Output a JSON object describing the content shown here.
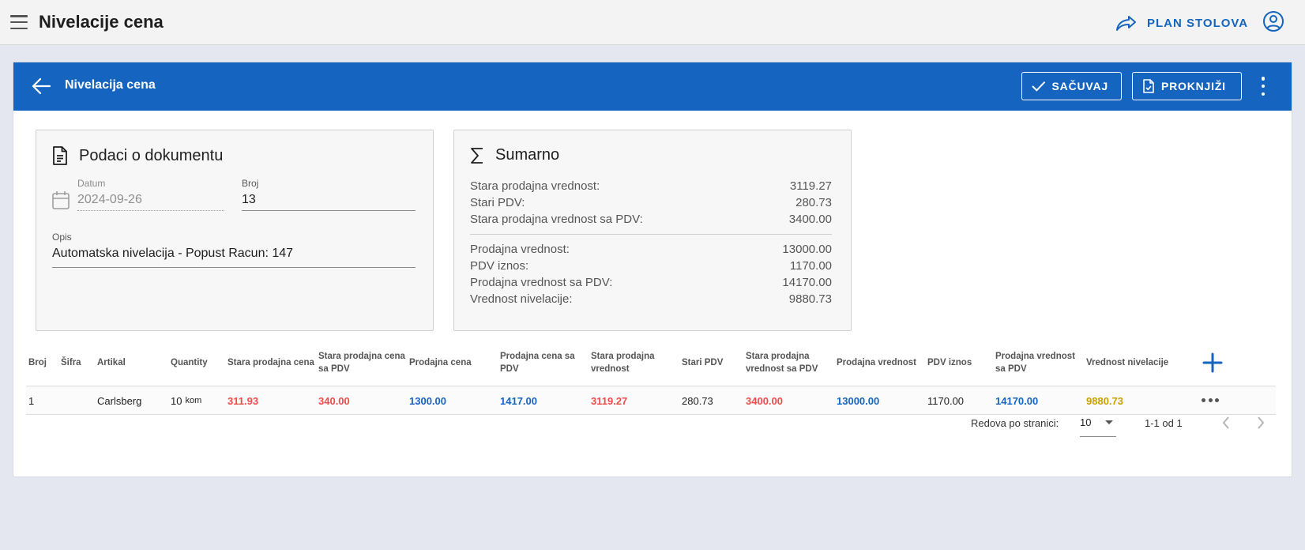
{
  "appbar": {
    "title": "Nivelacije cena",
    "plan_label": "PLAN STOLOVA"
  },
  "header": {
    "title": "Nivelacija cena",
    "save_label": "SAČUVAJ",
    "post_label": "PROKNJIŽI"
  },
  "doc_panel": {
    "heading": "Podaci o dokumentu",
    "date_label": "Datum",
    "date_value": "2024-09-26",
    "number_label": "Broj",
    "number_value": "13",
    "desc_label": "Opis",
    "desc_value": "Automatska nivelacija - Popust Racun: 147"
  },
  "summary": {
    "heading": "Sumarno",
    "old_rows": [
      {
        "label": "Stara prodajna vrednost:",
        "value": "3119.27"
      },
      {
        "label": "Stari PDV:",
        "value": "280.73"
      },
      {
        "label": "Stara prodajna vrednost sa PDV:",
        "value": "3400.00"
      }
    ],
    "new_rows": [
      {
        "label": "Prodajna vrednost:",
        "value": "13000.00"
      },
      {
        "label": "PDV iznos:",
        "value": "1170.00"
      },
      {
        "label": "Prodajna vrednost sa PDV:",
        "value": "14170.00"
      },
      {
        "label": "Vrednost nivelacije:",
        "value": "9880.73"
      }
    ]
  },
  "table": {
    "headers": [
      "Broj",
      "Šifra",
      "Artikal",
      "Quantity",
      "Stara prodajna cena",
      "Stara prodajna cena sa PDV",
      "Prodajna cena",
      "Prodajna cena sa PDV",
      "Stara prodajna vrednost",
      "Stari PDV",
      "Stara prodajna vrednost sa PDV",
      "Prodajna vrednost",
      "PDV iznos",
      "Prodajna vrednost sa PDV",
      "Vrednost nivelacije"
    ],
    "rows": [
      {
        "broj": "1",
        "sifra": "",
        "artikal": "Carlsberg",
        "quantity": "10",
        "unit": "kom",
        "stara_cena": "311.93",
        "stara_cena_pdv": "340.00",
        "prodajna_cena": "1300.00",
        "prodajna_cena_pdv": "1417.00",
        "stara_vrednost": "3119.27",
        "stari_pdv": "280.73",
        "stara_vrednost_pdv": "3400.00",
        "prodajna_vrednost": "13000.00",
        "pdv_iznos": "1170.00",
        "prodajna_vrednost_pdv": "14170.00",
        "vrednost_nivelacije": "9880.73"
      }
    ]
  },
  "pager": {
    "rows_label": "Redova po stranici:",
    "rows_value": "10",
    "range": "1-1 od 1"
  },
  "colors": {
    "primary": "#1565c0",
    "old_value": "#ef4b4b",
    "new_value": "#1565c0",
    "leveling": "#c9a000"
  }
}
